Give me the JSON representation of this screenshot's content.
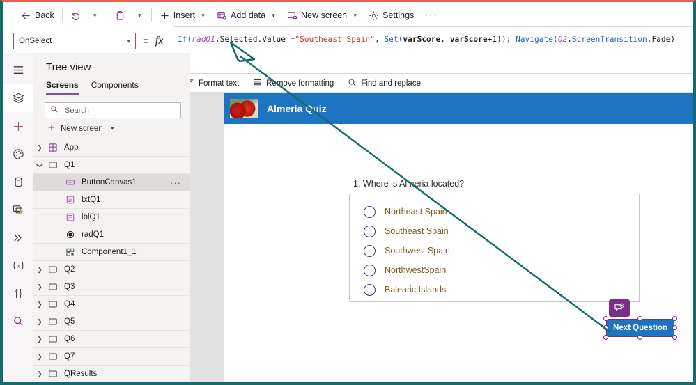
{
  "window": {
    "border_color": "#146b6b",
    "accent_top_color": "#e8604c"
  },
  "command_bar": {
    "items": [
      {
        "id": "back",
        "label": "Back",
        "icon": "arrow-left-icon",
        "caret": false
      },
      {
        "id": "undo",
        "label": "",
        "icon": "undo-icon",
        "caret": true
      },
      {
        "id": "paste",
        "label": "",
        "icon": "clipboard-icon",
        "caret": true
      },
      {
        "id": "insert",
        "label": "Insert",
        "icon": "plus-icon",
        "caret": true
      },
      {
        "id": "add-data",
        "label": "Add data",
        "icon": "database-add-icon",
        "caret": true
      },
      {
        "id": "new-screen",
        "label": "New screen",
        "icon": "screen-add-icon",
        "caret": true
      },
      {
        "id": "settings",
        "label": "Settings",
        "icon": "gear-icon",
        "caret": false
      }
    ],
    "overflow_label": "···"
  },
  "formula_bar": {
    "property": "OnSelect",
    "equals": "=",
    "fx": "fx",
    "formula_plain": "If(radQ1.Selected.Value =\"Southeast Spain\", Set(varScore, varScore+1)); Navigate(Q2,ScreenTransition.Fade)",
    "tokens": [
      {
        "t": "If(",
        "c": "tk-fn"
      },
      {
        "t": "radQ1",
        "c": "tk-id"
      },
      {
        "t": ".Selected.Value =",
        "c": "tk-pl"
      },
      {
        "t": "\"Southeast Spain\"",
        "c": "tk-str"
      },
      {
        "t": ", ",
        "c": "tk-pl"
      },
      {
        "t": "Set(",
        "c": "tk-fn"
      },
      {
        "t": "varScore",
        "c": "tk-var"
      },
      {
        "t": ", ",
        "c": "tk-pl"
      },
      {
        "t": "varScore",
        "c": "tk-var"
      },
      {
        "t": "+1)); ",
        "c": "tk-pl"
      },
      {
        "t": "Navigate(",
        "c": "tk-fn"
      },
      {
        "t": "Q2",
        "c": "tk-id"
      },
      {
        "t": ",",
        "c": "tk-pl"
      },
      {
        "t": "ScreenTransition",
        "c": "tk-enum"
      },
      {
        "t": ".Fade)",
        "c": "tk-pl"
      }
    ]
  },
  "format_toolbar": {
    "items": [
      {
        "id": "format-text",
        "label": "Format text",
        "icon": "format-text-icon"
      },
      {
        "id": "remove-formatting",
        "label": "Remove formatting",
        "icon": "remove-format-icon"
      },
      {
        "id": "find-and-replace",
        "label": "Find and replace",
        "icon": "search-icon"
      }
    ]
  },
  "rail": {
    "items": [
      {
        "id": "menu",
        "icon": "hamburger-menu-icon",
        "active": false
      },
      {
        "id": "tree-view",
        "icon": "layers-icon",
        "active": true
      },
      {
        "id": "insert",
        "icon": "plus-icon",
        "active": false
      },
      {
        "id": "theme",
        "icon": "palette-icon",
        "active": false
      },
      {
        "id": "data",
        "icon": "database-icon",
        "active": false
      },
      {
        "id": "media",
        "icon": "media-icon",
        "active": false
      },
      {
        "id": "power-fx",
        "icon": "chevrons-icon",
        "active": false
      },
      {
        "id": "variables",
        "icon": "variable-x-icon",
        "active": false
      },
      {
        "id": "settings",
        "icon": "sliders-icon",
        "active": false
      },
      {
        "id": "search",
        "icon": "search-icon",
        "active": false
      }
    ]
  },
  "tree_view": {
    "title": "Tree view",
    "tabs": [
      {
        "id": "screens",
        "label": "Screens",
        "selected": true
      },
      {
        "id": "components",
        "label": "Components",
        "selected": false
      }
    ],
    "search_placeholder": "Search",
    "search_value": "",
    "new_screen_label": "New screen",
    "items": [
      {
        "id": "app",
        "label": "App",
        "icon": "app-icon",
        "indent": 0,
        "chevron": "collapsed",
        "selected": false,
        "dots": false
      },
      {
        "id": "q1",
        "label": "Q1",
        "icon": "screen-icon",
        "indent": 0,
        "chevron": "expanded",
        "selected": false,
        "dots": false
      },
      {
        "id": "buttoncanvas1",
        "label": "ButtonCanvas1",
        "icon": "button-icon",
        "indent": 1,
        "chevron": "none",
        "selected": true,
        "dots": true
      },
      {
        "id": "txtq1",
        "label": "txtQ1",
        "icon": "label-icon",
        "indent": 1,
        "chevron": "none",
        "selected": false,
        "dots": false
      },
      {
        "id": "lblq1",
        "label": "lblQ1",
        "icon": "label-icon",
        "indent": 1,
        "chevron": "none",
        "selected": false,
        "dots": false
      },
      {
        "id": "radq1",
        "label": "radQ1",
        "icon": "radio-icon",
        "indent": 1,
        "chevron": "none",
        "selected": false,
        "dots": false
      },
      {
        "id": "component1_1",
        "label": "Component1_1",
        "icon": "component-icon",
        "indent": 1,
        "chevron": "none",
        "selected": false,
        "dots": false
      },
      {
        "id": "q2",
        "label": "Q2",
        "icon": "screen-icon",
        "indent": 0,
        "chevron": "collapsed",
        "selected": false,
        "dots": false
      },
      {
        "id": "q3",
        "label": "Q3",
        "icon": "screen-icon",
        "indent": 0,
        "chevron": "collapsed",
        "selected": false,
        "dots": false
      },
      {
        "id": "q4",
        "label": "Q4",
        "icon": "screen-icon",
        "indent": 0,
        "chevron": "collapsed",
        "selected": false,
        "dots": false
      },
      {
        "id": "q5",
        "label": "Q5",
        "icon": "screen-icon",
        "indent": 0,
        "chevron": "collapsed",
        "selected": false,
        "dots": false
      },
      {
        "id": "q6",
        "label": "Q6",
        "icon": "screen-icon",
        "indent": 0,
        "chevron": "collapsed",
        "selected": false,
        "dots": false
      },
      {
        "id": "q7",
        "label": "Q7",
        "icon": "screen-icon",
        "indent": 0,
        "chevron": "collapsed",
        "selected": false,
        "dots": false
      },
      {
        "id": "qresults",
        "label": "QResults",
        "icon": "screen-icon",
        "indent": 0,
        "chevron": "collapsed",
        "selected": false,
        "dots": false
      }
    ]
  },
  "app_preview": {
    "header_title": "Almeria Quiz",
    "header_color": "#1d74c0",
    "logo": "red-peppers-photo",
    "question": "1. Where is Almeria located?",
    "options": [
      {
        "id": "opt1",
        "label": "Northeast Spain",
        "selected": false
      },
      {
        "id": "opt2",
        "label": "Southeast Spain",
        "selected": false
      },
      {
        "id": "opt3",
        "label": "Southwest Spain",
        "selected": false
      },
      {
        "id": "opt4",
        "label": "NorthwestSpain",
        "selected": false
      },
      {
        "id": "opt5",
        "label": "Balearic Islands",
        "selected": false
      }
    ],
    "next_button_label": "Next Question",
    "next_button_color": "#1d74c0",
    "selection_color": "#7a2f86",
    "comment_badge_icon": "comment-add-icon"
  },
  "annotation": {
    "type": "arrow",
    "color": "#116b6b",
    "points_to": "formula-bar-formula-text"
  }
}
